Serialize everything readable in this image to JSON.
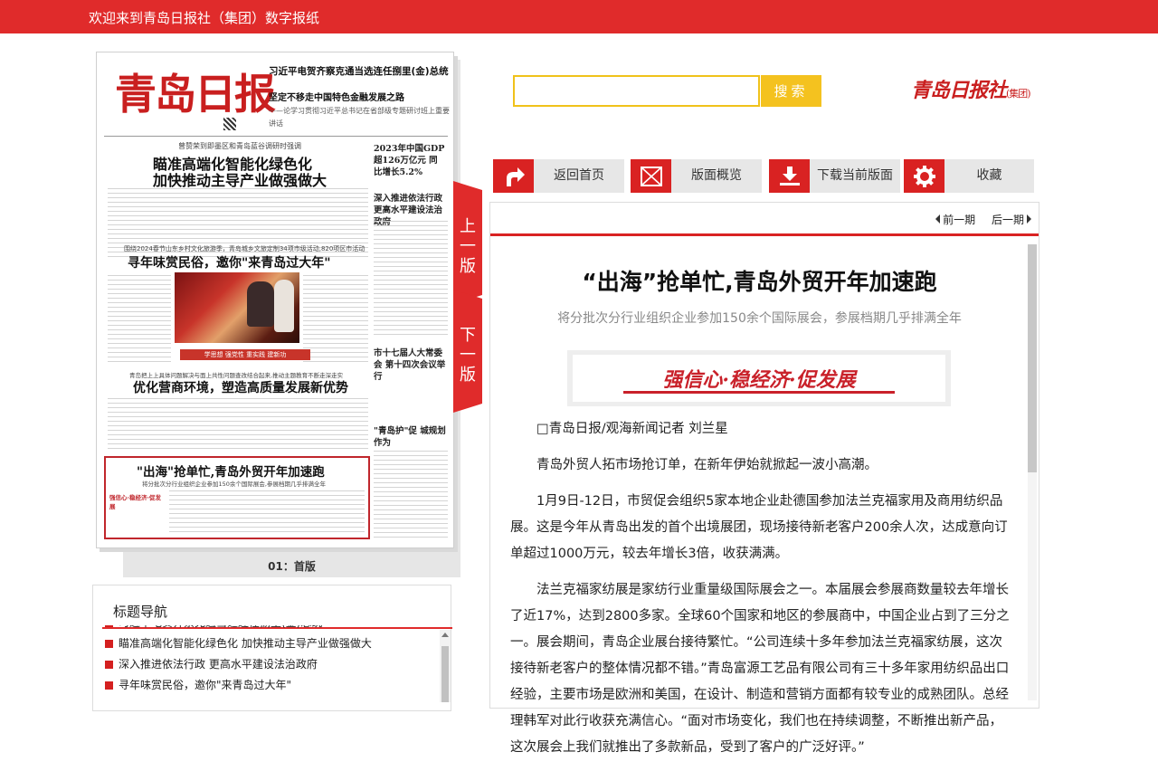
{
  "topbar": {
    "welcome": "欢迎来到青岛日报社（集团）数字报纸"
  },
  "newspaper": {
    "masthead": "青岛日报",
    "top_headline": "习近平电贺齐察克通当选连任捌里(金)总统",
    "second_headline": "坚定不移走中国特色金融发展之路",
    "second_kicker": "——论学习贯彻习近平总书记在省部级专题研讨班上重要讲话",
    "lead_kicker": "曾赞荣到即墨区和青岛蓝谷调研时强调",
    "lead_headline_1": "瞄准高端化智能化绿色化",
    "lead_headline_2": "加快推动主导产业做强做大",
    "gdp_box": "2023年中国GDP 超126万亿元 同比增长5.2%",
    "side_head_1": "深入推进依法行政 更高水平建设法治政府",
    "folk_kicker": "围绕2024春节山东乡村文化旅游季，青岛城乡文旅定制34项市级活动,820项区市活动",
    "folk_headline": "寻年味赏民俗，邀你\"来青岛过大年\"",
    "photo_banner": "学思想 强党性 重实践 建新功",
    "side_head_2": "市十七届人大常委会 第十四次会议举行",
    "biz_kicker": "青岛把上上具体问题解决与面上共性问题查改结合起来,推动主题教育不断走深走实",
    "biz_headline": "优化营商环境，塑造高质量发展新优势",
    "side_head_3": "\"青岛护\"促 城规划作为",
    "highlight_headline": "\"出海\"抢单忙,青岛外贸开年加速跑",
    "highlight_kicker": "将分批次分行业组织企业参加150余个国际展会,参展档期几乎排满全年",
    "highlight_strip": "强信心·稳经济·促发展"
  },
  "page_label": "01：首版",
  "tabs": {
    "prev": "上一版",
    "next": "下一版"
  },
  "nav": {
    "title": "标题导航",
    "items": [
      "习近平电贺齐察克通当选连任捌里(金)总统",
      "瞄准高端化智能化绿色化 加快推动主导产业做强做大",
      "深入推进依法行政 更高水平建设法治政府",
      "寻年味赏民俗，邀你\"来青岛过大年\""
    ]
  },
  "search": {
    "button": "搜索",
    "value": ""
  },
  "logo": {
    "name": "青岛日报社",
    "suffix": "(集团)"
  },
  "toolbar": {
    "home": "返回首页",
    "overview": "版面概览",
    "download": "下载当前版面",
    "favorite": "收藏"
  },
  "pager": {
    "prev": "前一期",
    "next": "后一期"
  },
  "article": {
    "title": "“出海”抢单忙,青岛外贸开年加速跑",
    "subtitle": "将分批次分行业组织企业参加150余个国际展会，参展档期几乎排满全年",
    "banner": "强信心·稳经济·促发展",
    "byline": "□青岛日报/观海新闻记者  刘兰星",
    "p1": "青岛外贸人拓市场抢订单，在新年伊始就掀起一波小高潮。",
    "p2": "1月9日-12日，市贸促会组织5家本地企业赴德国参加法兰克福家用及商用纺织品展。这是今年从青岛出发的首个出境展团，现场接待新老客户200余人次，达成意向订单超过1000万元，较去年增长3倍，收获满满。",
    "p3": "法兰克福家纺展是家纺行业重量级国际展会之一。本届展会参展商数量较去年增长了近17%，达到2800多家。全球60个国家和地区的参展商中，中国企业占到了三分之一。展会期间，青岛企业展台接待繁忙。“公司连续十多年参加法兰克福家纺展，这次接待新老客户的整体情况都不错。”青岛富源工艺品有限公司有三十多年家用纺织品出口经验，主要市场是欧洲和美国，在设计、制造和营销方面都有较专业的成熟团队。总经理韩军对此行收获充满信心。“面对市场变化，我们也在持续调整，不断推出新产品，这次展会上我们就推出了多款新品，受到了客户的广泛好评。”"
  },
  "colors": {
    "brand_red": "#e02b2b",
    "search_yellow": "#f4c21f"
  }
}
